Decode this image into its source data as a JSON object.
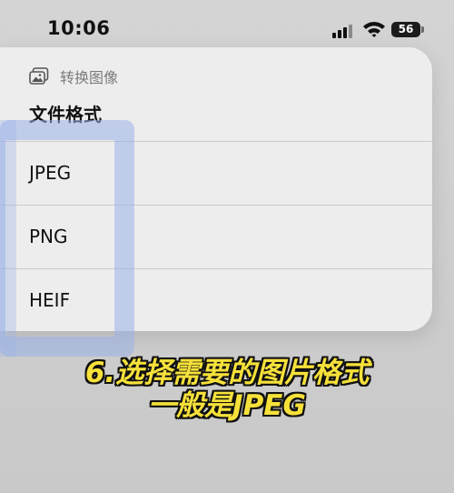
{
  "status_bar": {
    "time": "10:06",
    "battery_level": "56"
  },
  "menu": {
    "title": "转换图像",
    "section_label": "文件格式",
    "options": [
      {
        "label": "JPEG"
      },
      {
        "label": "PNG"
      },
      {
        "label": "HEIF"
      }
    ]
  },
  "caption": {
    "line1": "6.选择需要的图片格式",
    "line2": "一般是JPEG"
  },
  "colors": {
    "caption_text": "#f6e13a",
    "caption_outline": "#111111",
    "highlight": "#9bb2e8"
  }
}
